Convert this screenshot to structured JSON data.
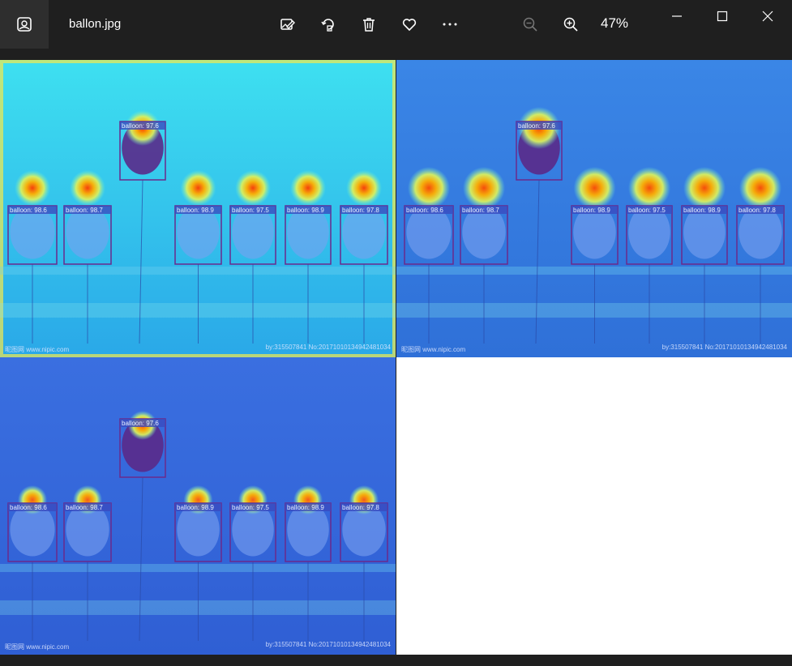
{
  "window": {
    "title": "ballon.jpg",
    "zoom": "47%"
  },
  "toolbar": {
    "buttons": [
      {
        "name": "edit-image-button",
        "icon": "edit-image-icon"
      },
      {
        "name": "rotate-button",
        "icon": "rotate-icon"
      },
      {
        "name": "delete-button",
        "icon": "trash-icon"
      },
      {
        "name": "favorite-button",
        "icon": "heart-icon"
      },
      {
        "name": "more-button",
        "icon": "more-icon"
      },
      {
        "name": "zoom-out-button",
        "icon": "zoom-out-icon"
      },
      {
        "name": "zoom-in-button",
        "icon": "zoom-in-icon"
      }
    ]
  },
  "detections": {
    "label_prefix": "balloon: ",
    "scores": [
      "97.6",
      "98.6",
      "98.7",
      "98.9",
      "97.5",
      "98.9",
      "97.8"
    ]
  },
  "watermark": {
    "left": "昵图网 www.nipic.com",
    "right": "by:315507841 No:20171010134942481034"
  },
  "colors": {
    "chrome": "#1f1f1f",
    "box": "#6a2a8c",
    "label_bg": "#3a4bbf"
  }
}
